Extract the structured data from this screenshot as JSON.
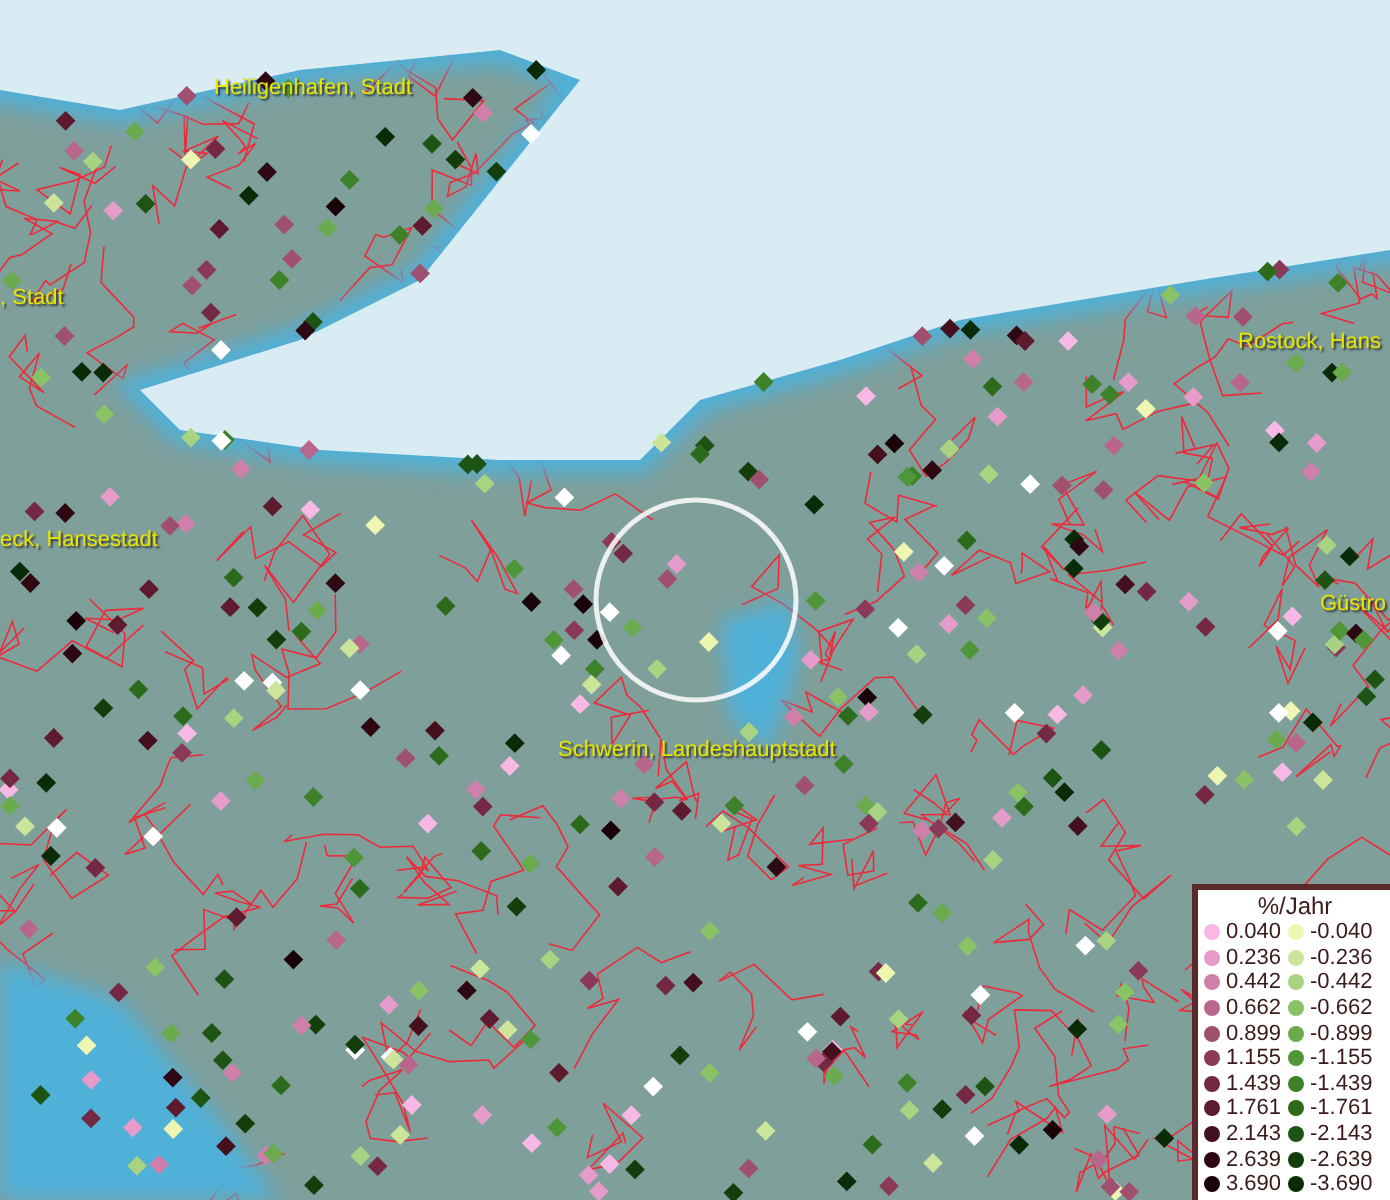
{
  "map": {
    "places": [
      {
        "label": "Heiligenhafen, Stadt"
      },
      {
        "label": ", Stadt"
      },
      {
        "label": "eck, Hansestadt"
      },
      {
        "label": "Rostock, Hans"
      },
      {
        "label": "Güstro"
      },
      {
        "label": "Schwerin, Landeshauptstadt"
      }
    ]
  },
  "legend": {
    "title": "%/Jahr",
    "positive": [
      {
        "value": "0.040",
        "color": "#f7b8e6"
      },
      {
        "value": "0.236",
        "color": "#e59ccb"
      },
      {
        "value": "0.442",
        "color": "#cf80aa"
      },
      {
        "value": "0.662",
        "color": "#b86689"
      },
      {
        "value": "0.899",
        "color": "#a0506f"
      },
      {
        "value": "1.155",
        "color": "#8a3a57"
      },
      {
        "value": "1.439",
        "color": "#742843"
      },
      {
        "value": "1.761",
        "color": "#5e1a2e"
      },
      {
        "value": "2.143",
        "color": "#45101e"
      },
      {
        "value": "2.639",
        "color": "#2e0812"
      },
      {
        "value": "3.690",
        "color": "#1a0308"
      }
    ],
    "negative": [
      {
        "value": "-0.040",
        "color": "#eef6b2"
      },
      {
        "value": "-0.236",
        "color": "#cde59b"
      },
      {
        "value": "-0.442",
        "color": "#a8d481"
      },
      {
        "value": "-0.662",
        "color": "#8ac266"
      },
      {
        "value": "-0.899",
        "color": "#6aab4e"
      },
      {
        "value": "-1.155",
        "color": "#4f9638"
      },
      {
        "value": "-1.439",
        "color": "#3d8128"
      },
      {
        "value": "-1.761",
        "color": "#2c6b1c"
      },
      {
        "value": "-2.143",
        "color": "#1d5413"
      },
      {
        "value": "-2.639",
        "color": "#133e0c"
      },
      {
        "value": "-3.690",
        "color": "#0b2a07"
      }
    ]
  }
}
